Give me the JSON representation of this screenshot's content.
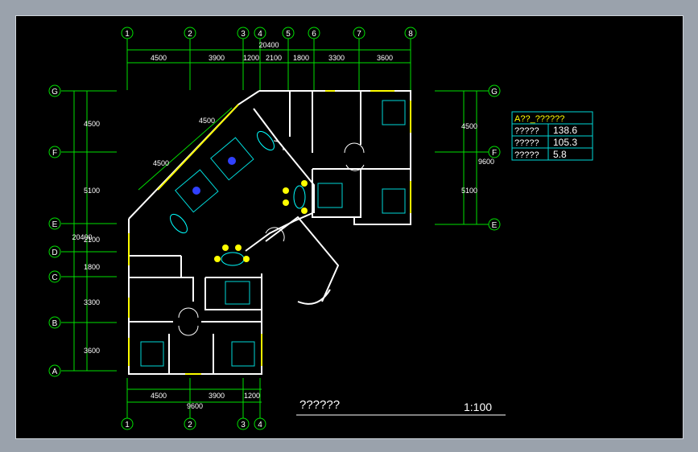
{
  "grid_top": [
    "1",
    "2",
    "3",
    "4",
    "5",
    "6",
    "7",
    "8"
  ],
  "grid_bottom": [
    "1",
    "2",
    "3",
    "4"
  ],
  "grid_left": [
    "G",
    "F",
    "E",
    "D",
    "C",
    "B",
    "A"
  ],
  "grid_right": [
    "G",
    "F",
    "E"
  ],
  "dims_top": [
    "4500",
    "3900",
    "1200",
    "2100",
    "1800",
    "3300",
    "3600"
  ],
  "dim_top_total": "20400",
  "dims_left": [
    "4500",
    "5100",
    "2100",
    "1800",
    "3300",
    "3600"
  ],
  "dim_left_total": "20400",
  "dims_right": [
    "4500",
    "5100"
  ],
  "dim_right_total": "9600",
  "dims_bottom": [
    "4500",
    "3900",
    "1200"
  ],
  "dim_bottom_total": "9600",
  "diag_dims": [
    "4500",
    "4500"
  ],
  "area_table": [
    {
      "label": "A??_??????",
      "value": ""
    },
    {
      "label": "?????",
      "value": "138.6"
    },
    {
      "label": "?????",
      "value": "105.3"
    },
    {
      "label": "?????",
      "value": "5.8"
    }
  ],
  "title_block": {
    "name": "??????",
    "scale": "1:100"
  },
  "colors": {
    "grid": "#00e000",
    "wall": "#ffffff",
    "window": "#ffff00",
    "furniture": "#00d8d8",
    "table": "#00ffff",
    "bubble": "#00e000",
    "accent": "#3040ff"
  }
}
